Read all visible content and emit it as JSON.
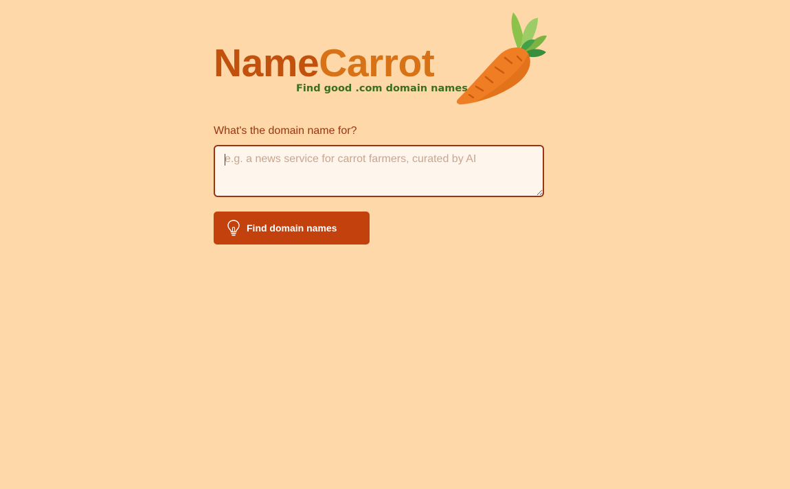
{
  "logo": {
    "name_part": "Name",
    "carrot_part": "Carrot",
    "tagline": "Find good .com domain names"
  },
  "form": {
    "label": "What's the domain name for?",
    "description_placeholder": "e.g. a news service for carrot farmers, curated by AI",
    "description_value": "",
    "submit_label": "Find domain names",
    "submit_icon": "lightbulb-icon"
  },
  "colors": {
    "background": "#FED8A8",
    "brand_dark_orange": "#C2510E",
    "brand_orange": "#D77316",
    "tagline_green": "#3B6E1F",
    "accent": "#C2410C",
    "label_text": "#9A3412"
  }
}
